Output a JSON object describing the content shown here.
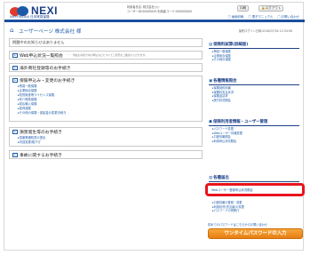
{
  "header": {
    "brand": "NEXI",
    "brand_sub": "NIPPONEXIA 日本貿易保険",
    "info_line1": "利用者氏名: 株式会社○○",
    "info_line2": "ユーザーID:00000000    利用者コード:000000000",
    "info_line3": "利用者コード:0000000000",
    "print_button": "印刷",
    "logout_button": "ログアウト",
    "links": [
      "□ 画面印刷",
      "□ 電子マニュアル",
      "□ お問い合わせ"
    ]
  },
  "breadcrumb": {
    "home_icon": "home-icon",
    "label": "ユーザーページ  株式会社 様",
    "date": "最終ログイン日時:2018/07/04 12:34:56"
  },
  "left": {
    "notice": "問題中のお知らせはありません",
    "web_apply_title": "Web申込状況一覧照会",
    "web_apply_note": "・・・現在お手続き中の申込などについてご状況をご確認いただけます。",
    "overseas_title": "海外商社登録等のお手続き",
    "insurance_title": "保険申込み・変更のお手続き",
    "insurance_items": [
      "貿易一般保険",
      "企業総合保険",
      "知的財産等ライセンス保険",
      "仲介貿易保険",
      "前払輸入保険",
      "投資保険",
      "その他の保険・保証金の変更手続き"
    ],
    "claim_title": "損害発生等のお手続き",
    "claim_items": [
      "損害等通知書の提出",
      "内容変更/取下げ"
    ],
    "after_title": "事故に関するお手続き"
  },
  "right": {
    "sec1_head": "保険料試算(詳細版)",
    "sec1_items": [
      "貿易一般保険",
      "企業総合保険",
      "その他の保険"
    ],
    "sec2_head": "各種情報照会",
    "sec2_items": [
      "保険契約情報",
      "保険料支払状況",
      "保険金請求",
      "受付状況照会"
    ],
    "sec3_head": "保険利用者情報・ユーザー管理",
    "sec3_items": [
      "パスワード変更",
      "Webユーザー情報変更",
      "口座情報照会",
      "利用申込状況照会"
    ],
    "sec4_head": "各種届出",
    "sec4_highlight": "Webユーザー登録申込状況照会",
    "sec4_items": [
      "口座情報の登録・変更",
      "利用状況(担当者)の変更",
      "パスワードの再発行"
    ],
    "help_text": "初めてのパスワードはこちらからお問い合わせ",
    "cta_button": "ワンタイムパスワードの入力"
  }
}
